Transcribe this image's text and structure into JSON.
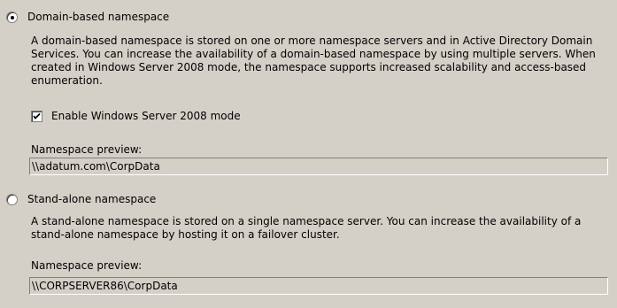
{
  "domain_option": {
    "label": "Domain-based namespace",
    "selected": true,
    "description": "A domain-based namespace is stored on one or more namespace servers and in Active Directory Domain Services. You can increase the availability of a domain-based namespace by using multiple servers. When created in Windows Server 2008 mode, the namespace supports increased scalability and access-based enumeration.",
    "enable_mode_label": "Enable Windows Server 2008 mode",
    "enable_mode_checked": true,
    "preview_label": "Namespace preview:",
    "preview_value": "\\\\adatum.com\\CorpData"
  },
  "standalone_option": {
    "label": "Stand-alone namespace",
    "selected": false,
    "description": "A stand-alone namespace is stored on a single namespace server. You can increase the availability of a stand-alone namespace by hosting it on a failover cluster.",
    "preview_label": "Namespace preview:",
    "preview_value": "\\\\CORPSERVER86\\CorpData"
  }
}
